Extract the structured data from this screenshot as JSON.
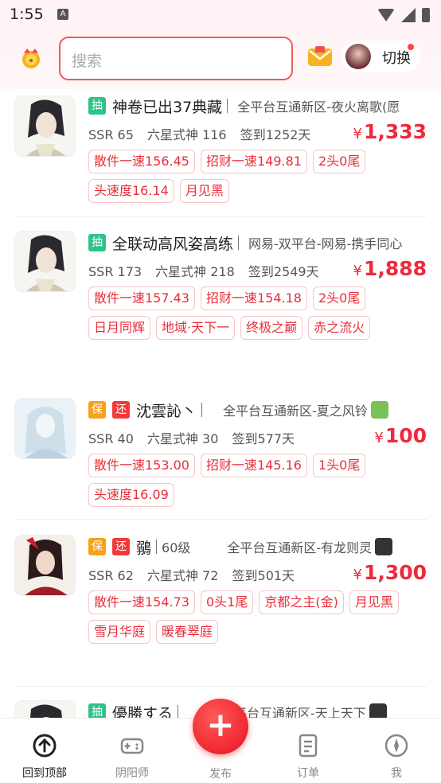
{
  "status_bar": {
    "time": "1:55",
    "notif_letter": "A"
  },
  "header": {
    "search_placeholder": "搜索",
    "switch_label": "切换"
  },
  "colors": {
    "accent_red": "#f0283c",
    "chou_green": "#2fc38a",
    "bao_orange": "#f7a21b",
    "huan_red": "#f23a3a"
  },
  "listings": [
    {
      "tags": [
        "抽"
      ],
      "title": "神卷已出37典藏",
      "suffix": "",
      "server": "全平台互通新区-夜火离歌(愿",
      "os": "",
      "ssr": "SSR 65",
      "six_star": "六星式神 116",
      "signin": "签到1252天",
      "price_symbol": "¥",
      "price": "1,333",
      "chips": [
        "散件一速156.45",
        "招财一速149.81",
        "2头0尾",
        "头速度16.14",
        "月见黑"
      ]
    },
    {
      "tags": [
        "抽"
      ],
      "title": "全联动高风姿高练",
      "suffix": "",
      "server": "网易-双平台-网易-携手同心",
      "os": "",
      "ssr": "SSR 173",
      "six_star": "六星式神 218",
      "signin": "签到2549天",
      "price_symbol": "¥",
      "price": "1,888",
      "chips": [
        "散件一速157.43",
        "招财一速154.18",
        "2头0尾",
        "日月同辉",
        "地域·天下一",
        "终极之巅",
        "赤之流火"
      ]
    },
    {
      "tags": [
        "保",
        "还"
      ],
      "title": "沈雲訫丶",
      "suffix": "",
      "server": "全平台互通新区-夏之风铃",
      "os": "android-icon",
      "ssr": "SSR 40",
      "six_star": "六星式神 30",
      "signin": "签到577天",
      "price_symbol": "¥",
      "price": "100",
      "chips": [
        "散件一速153.00",
        "招财一速145.16",
        "1头0尾",
        "头速度16.09"
      ]
    },
    {
      "tags": [
        "保",
        "还"
      ],
      "title": "鶸",
      "suffix": "60级",
      "server": "全平台互通新区-有龙则灵",
      "os": "apple-icon",
      "ssr": "SSR 62",
      "six_star": "六星式神 72",
      "signin": "签到501天",
      "price_symbol": "¥",
      "price": "1,300",
      "chips": [
        "散件一速154.73",
        "0头1尾",
        "京都之主(金)",
        "月见黑",
        "雪月华庭",
        "暖春翠庭"
      ]
    },
    {
      "tags": [
        "抽"
      ],
      "title": "優勝する",
      "suffix": "",
      "server": "全平台互通新区-天上天下",
      "os": "apple-icon"
    }
  ],
  "nav": {
    "items": [
      "回到顶部",
      "阴阳师",
      "发布",
      "订单",
      "我"
    ]
  }
}
